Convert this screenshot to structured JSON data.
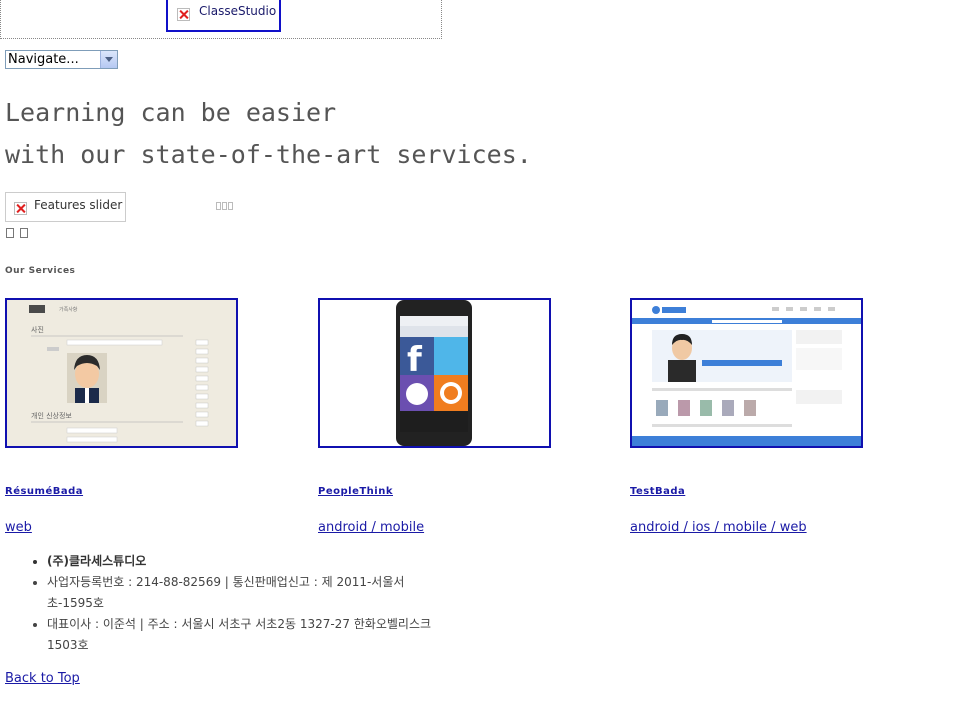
{
  "header": {
    "logo_alt": "ClasseStudio",
    "navigate_label": "Navigate..."
  },
  "hero": {
    "line1": "Learning can be easier",
    "line2": "with our state-of-the-art services."
  },
  "slider": {
    "alt": "Features slider"
  },
  "services": {
    "title": "Our Services",
    "items": [
      {
        "name": "RésuméBada",
        "tags": "web"
      },
      {
        "name": "PeopleThink",
        "tags": "android / mobile"
      },
      {
        "name": "TestBada",
        "tags": "android / ios / mobile / web"
      }
    ],
    "resume_mock": {
      "tab1": "학력 정보",
      "tab2": "가족사항",
      "section1": "사진",
      "section2": "개인 신상정보"
    }
  },
  "footer": {
    "items": [
      "(주)클라세스튜디오",
      "사업자등록번호 : 214-88-82569 | 통신판매업신고 : 제 2011-서울서초-1595호",
      "대표이사 : 이준석 | 주소 : 서울시 서초구 서초2동 1327-27 한화오벨리스크 1503호"
    ],
    "back_to_top": "Back to Top"
  },
  "colors": {
    "link": "#1a1aa6",
    "image_border": "#1010b0"
  }
}
